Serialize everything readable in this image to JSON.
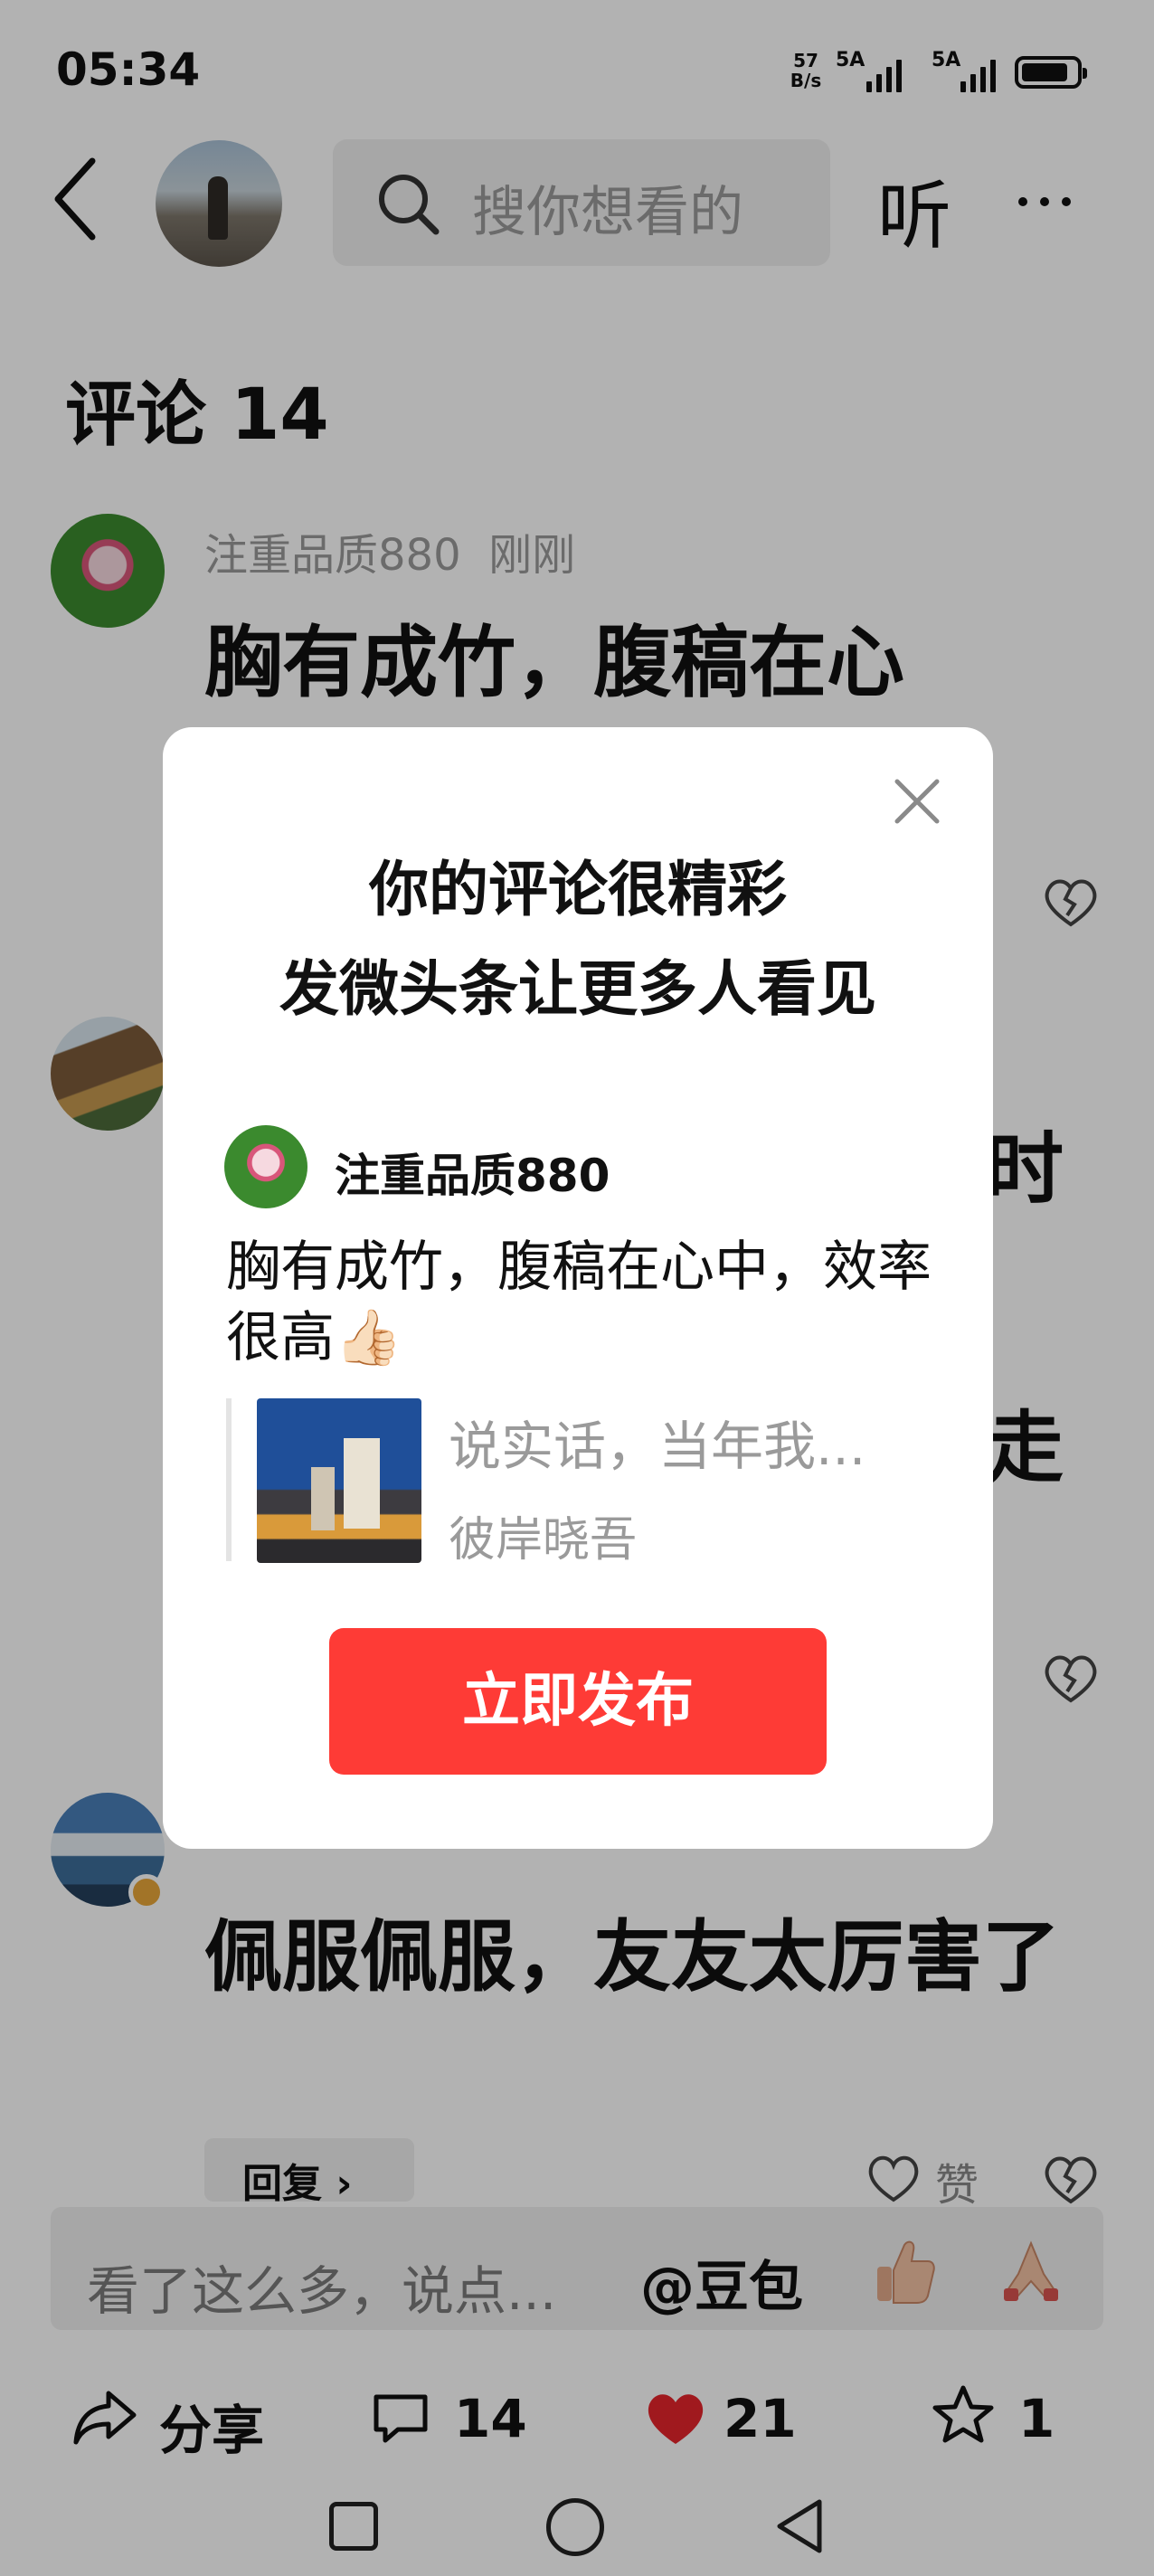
{
  "status_bar": {
    "time": "05:34",
    "net_speed_value": "57",
    "net_speed_unit": "B/s",
    "signal1": "5A",
    "signal2": "5A",
    "battery_level": 0.9
  },
  "header": {
    "search_placeholder": "搜你想看的",
    "listen_label": "听"
  },
  "comments_section": {
    "title": "评论 14",
    "comments": [
      {
        "user": "注重品质880",
        "time": "刚刚",
        "text": "胸有成竹，腹稿在心"
      },
      {
        "fragment1": "时",
        "fragment2": "走"
      },
      {
        "text": "佩服佩服，友友太厉害了",
        "reply_label": "回复 ›",
        "like_label": "赞"
      }
    ]
  },
  "input_bar": {
    "placeholder": "看了这么多，说点...",
    "mention": "@豆包"
  },
  "bottom_bar": {
    "share_label": "分享",
    "comment_count": "14",
    "like_count": "21",
    "favorite_count": "1",
    "like_color": "#e5242b"
  },
  "modal": {
    "title_line1": "你的评论很精彩",
    "title_line2": "发微头条让更多人看见",
    "user": "注重品质880",
    "comment": "胸有成竹，腹稿在心中，效率很高👍🏻",
    "quote_text": "说实话，当年我...",
    "quote_author": "彼岸晓吾",
    "publish_label": "立即发布",
    "publish_color": "#fe3b36"
  }
}
